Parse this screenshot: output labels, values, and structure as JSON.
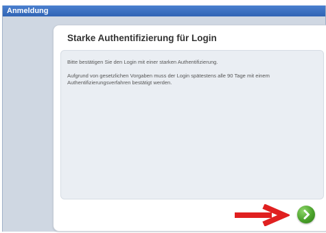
{
  "window": {
    "title": "Anmeldung"
  },
  "card": {
    "title": "Starke Authentifizierung für Login",
    "paragraph1": "Bitte bestätigen Sie den Login mit einer starken Authentifizierung.",
    "paragraph2": "Aufgrund von gesetzlichen Vorgaben muss der Login spätestens alle 90 Tage mit einem Authentifizierungsverfahren bestätigt werden."
  },
  "next_button": {
    "icon": "chevron-right-icon",
    "color": "#4aa12a"
  },
  "annotation": {
    "icon": "red-arrow-right",
    "color": "#e02020"
  }
}
